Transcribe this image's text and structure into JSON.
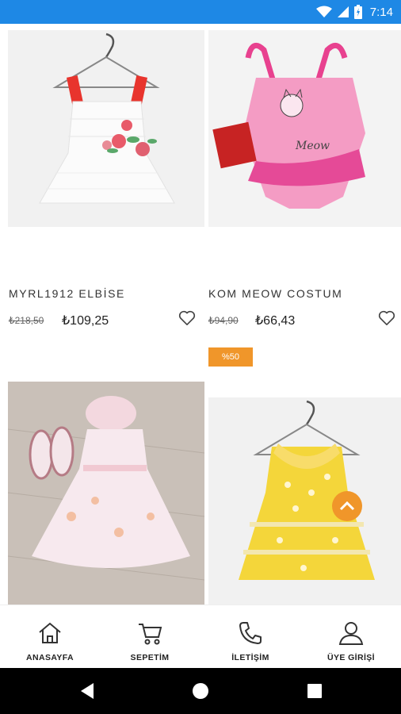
{
  "status_bar": {
    "time": "7:14",
    "color": "#1e88e5"
  },
  "products": [
    {
      "name": "MYRL1912 ELBİSE",
      "old_price": "₺218,50",
      "price": "₺109,25"
    },
    {
      "name": "KOM MEOW COSTUM",
      "old_price": "₺94,90",
      "price": "₺66,43"
    },
    {
      "badge": "%50"
    },
    {}
  ],
  "icons": {
    "favorite": "heart-outline-icon",
    "home": "home-icon",
    "cart": "cart-icon",
    "contact": "phone-icon",
    "member": "user-icon"
  },
  "bottom_nav": [
    {
      "label": "ANASAYFA"
    },
    {
      "label": "SEPETİM"
    },
    {
      "label": "İLETİŞİM"
    },
    {
      "label": "ÜYE GİRİŞİ"
    }
  ],
  "colors": {
    "badge": "#f0962a",
    "accent": "#1e88e5"
  }
}
